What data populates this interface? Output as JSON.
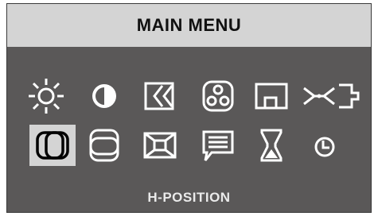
{
  "menu": {
    "title": "MAIN MENU",
    "status_label": "H-POSITION",
    "selected_item": "h-position"
  },
  "icons": {
    "row1": [
      "brightness-icon",
      "contrast-icon",
      "phase-icon",
      "color-icon",
      "size-icon",
      "center-icon"
    ],
    "row2": [
      "h-position-icon",
      "v-position-icon",
      "zoom-icon",
      "osd-language-icon",
      "recall-icon",
      "timer-icon"
    ]
  },
  "colors": {
    "panel": "#5a5858",
    "title_bar": "#d4d4d4",
    "icon": "#ffffff",
    "selected_icon": "#000000"
  }
}
